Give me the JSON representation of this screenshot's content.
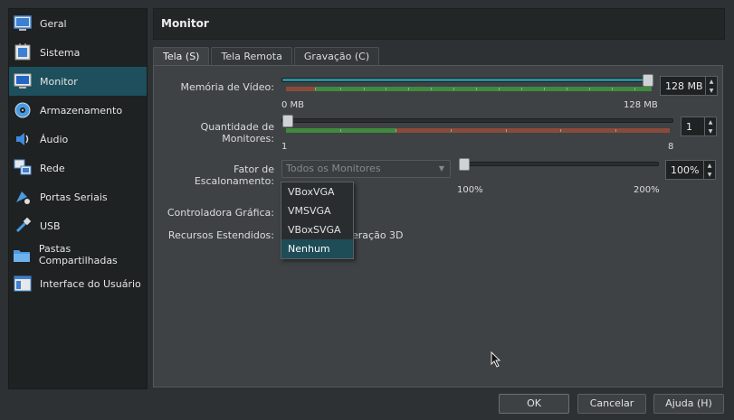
{
  "sidebar": {
    "items": [
      {
        "label": "Geral",
        "icon": "general-monitor-icon"
      },
      {
        "label": "Sistema",
        "icon": "system-chip-icon"
      },
      {
        "label": "Monitor",
        "icon": "display-monitor-icon",
        "active": true
      },
      {
        "label": "Armazenamento",
        "icon": "storage-disk-icon"
      },
      {
        "label": "Áudio",
        "icon": "speaker-icon"
      },
      {
        "label": "Rede",
        "icon": "network-icon"
      },
      {
        "label": "Portas Seriais",
        "icon": "serial-port-icon"
      },
      {
        "label": "USB",
        "icon": "usb-icon"
      },
      {
        "label": "Pastas Compartilhadas",
        "icon": "shared-folder-icon"
      },
      {
        "label": "Interface do Usuário",
        "icon": "user-interface-icon"
      }
    ]
  },
  "header": {
    "title": "Monitor"
  },
  "tabs": [
    {
      "label": "Tela (S)",
      "active": true
    },
    {
      "label": "Tela Remota"
    },
    {
      "label": "Gravação (C)"
    }
  ],
  "screen": {
    "video_memory": {
      "label": "Memória de Vídeo:",
      "value": "128 MB",
      "min_label": "0 MB",
      "max_label": "128 MB",
      "fraction": 1.0
    },
    "monitor_count": {
      "label": "Quantidade de Monitores:",
      "value": "1",
      "min_label": "1",
      "max_label": "8",
      "fraction": 0.0
    },
    "scale_factor": {
      "label": "Fator de Escalonamento:",
      "combo_value": "Todos os Monitores",
      "value": "100%",
      "min_label": "100%",
      "max_label": "200%",
      "fraction": 0.0
    },
    "graphics_controller": {
      "label": "Controladora Gráfica:"
    },
    "extended_features": {
      "label": "Recursos Estendidos:",
      "partial_text": "eração 3D"
    },
    "dropdown_options": [
      "VBoxVGA",
      "VMSVGA",
      "VBoxSVGA",
      "Nenhum"
    ],
    "dropdown_selected": "Nenhum"
  },
  "buttons": {
    "ok": "OK",
    "cancel": "Cancelar",
    "help": "Ajuda (H)"
  },
  "colors": {
    "accent": "#2b8d9a",
    "selected": "#1d4f5c",
    "green": "#3f8a3f",
    "red": "#8a4a3a"
  }
}
